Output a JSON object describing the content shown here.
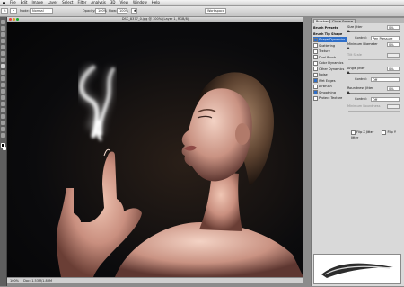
{
  "menu": {
    "items": [
      "",
      "File",
      "Edit",
      "Image",
      "Layer",
      "Select",
      "Filter",
      "Analysis",
      "3D",
      "View",
      "Window",
      "Help"
    ]
  },
  "options": {
    "mode_label": "Mode:",
    "mode_value": "Normal",
    "opacity_label": "Opacity:",
    "opacity_value": "100%",
    "flow_label": "Flow:",
    "flow_value": "100%",
    "workspace_label": "Workspace"
  },
  "document": {
    "title": "DSC_8377_0.jpg @ 100% (Layer 1, RGB/8)",
    "status": "Doc: 1.53M/1.83M"
  },
  "panel": {
    "tabs": [
      "Brushes",
      "Clone Source"
    ],
    "list": [
      {
        "label": "Brush Presets",
        "kind": "header",
        "checked": null
      },
      {
        "label": "Brush Tip Shape",
        "kind": "header",
        "checked": null
      },
      {
        "label": "Shape Dynamics",
        "kind": "selected",
        "checked": true
      },
      {
        "label": "Scattering",
        "kind": "item",
        "checked": false
      },
      {
        "label": "Texture",
        "kind": "item",
        "checked": false
      },
      {
        "label": "Dual Brush",
        "kind": "item",
        "checked": false
      },
      {
        "label": "Color Dynamics",
        "kind": "item",
        "checked": false
      },
      {
        "label": "Other Dynamics",
        "kind": "item",
        "checked": false
      },
      {
        "label": "Noise",
        "kind": "item",
        "checked": false
      },
      {
        "label": "Wet Edges",
        "kind": "item",
        "checked": true
      },
      {
        "label": "Airbrush",
        "kind": "item",
        "checked": false
      },
      {
        "label": "Smoothing",
        "kind": "item",
        "checked": true
      },
      {
        "label": "Protect Texture",
        "kind": "item",
        "checked": false
      }
    ],
    "size_jitter_label": "Size Jitter",
    "size_jitter_value": "0%",
    "control_label": "Control:",
    "control_value": "Pen Pressure",
    "min_diameter_label": "Minimum Diameter",
    "min_diameter_value": "0%",
    "tilt_scale_label": "Tilt Scale",
    "angle_jitter_label": "Angle Jitter",
    "angle_jitter_value": "0%",
    "angle_control_value": "Off",
    "roundness_jitter_label": "Roundness Jitter",
    "roundness_jitter_value": "0%",
    "roundness_control_value": "Off",
    "min_roundness_label": "Minimum Roundness",
    "flip_x_label": "Flip X Jitter",
    "flip_y_label": "Flip Y Jitter"
  },
  "colors": {
    "selection": "#2f6fc9",
    "panel_bg": "#d9d9d9"
  }
}
